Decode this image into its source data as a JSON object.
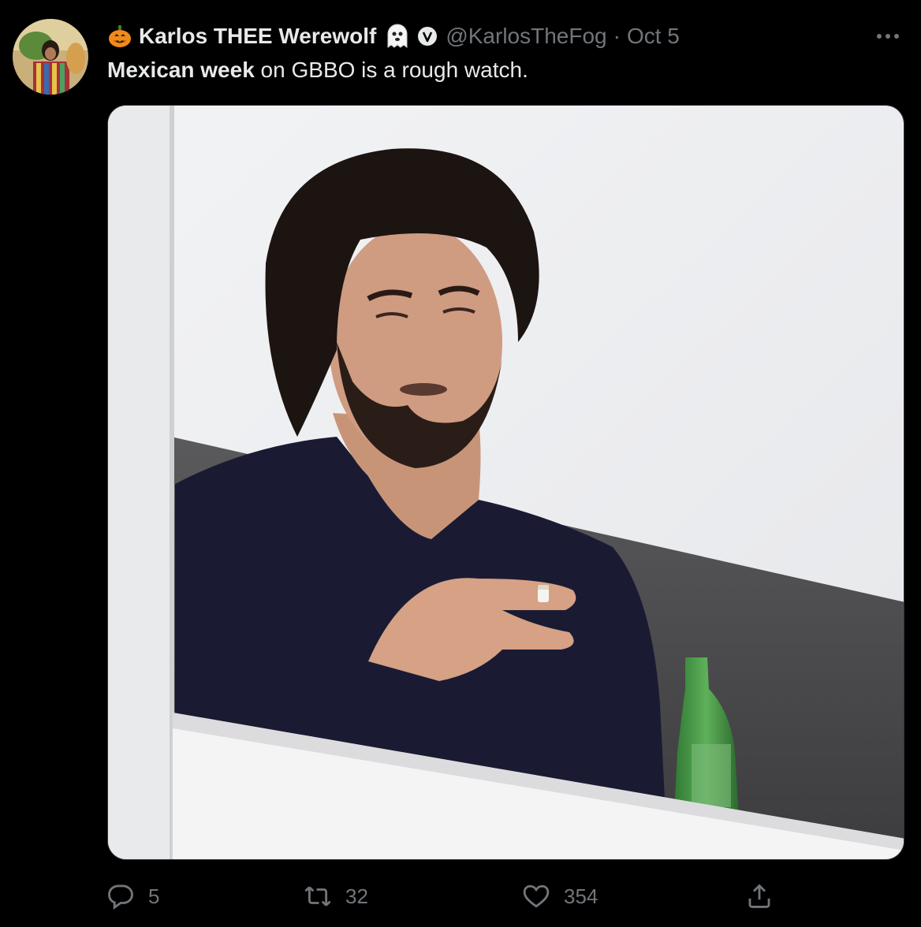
{
  "tweet": {
    "display_name": "Karlos THEE Werewolf",
    "name_prefix_emoji": "pumpkin-emoji",
    "name_suffix_emoji": "ghost-emoji",
    "verified_badge": "v-badge",
    "handle": "@KarlosTheFog",
    "separator": "·",
    "date": "Oct 5",
    "text_bold": "Mexican week",
    "text_rest": " on GBBO is a rough watch.",
    "more_icon": "more-options-icon"
  },
  "actions": {
    "reply": {
      "icon": "reply-icon",
      "count": "5"
    },
    "retweet": {
      "icon": "retweet-icon",
      "count": "32"
    },
    "like": {
      "icon": "heart-icon",
      "count": "354"
    },
    "share": {
      "icon": "share-icon"
    }
  },
  "colors": {
    "background": "#000000",
    "text_primary": "#e7e9ea",
    "text_secondary": "#71767b",
    "border": "#2f3336"
  }
}
